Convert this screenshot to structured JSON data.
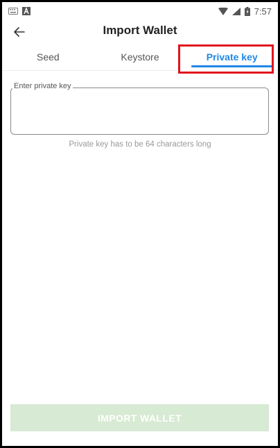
{
  "status_bar": {
    "time": "7:57",
    "icons": [
      "keyboard-icon",
      "notification-a-icon",
      "wifi-icon",
      "signal-icon",
      "battery-icon"
    ]
  },
  "toolbar": {
    "back_icon": "arrow-left-icon",
    "title": "Import Wallet"
  },
  "tabs": [
    {
      "label": "Seed",
      "active": false
    },
    {
      "label": "Keystore",
      "active": false
    },
    {
      "label": "Private key",
      "active": true
    }
  ],
  "private_key_field": {
    "label": "Enter private key",
    "value": "",
    "helper": "Private key has to be 64 characters long"
  },
  "import_button": {
    "label": "IMPORT WALLET",
    "enabled": false
  },
  "colors": {
    "accent": "#1e88e5",
    "highlight": "#e0141d",
    "button_disabled": "#d7ead3",
    "helper_text": "#9a9a9a"
  }
}
